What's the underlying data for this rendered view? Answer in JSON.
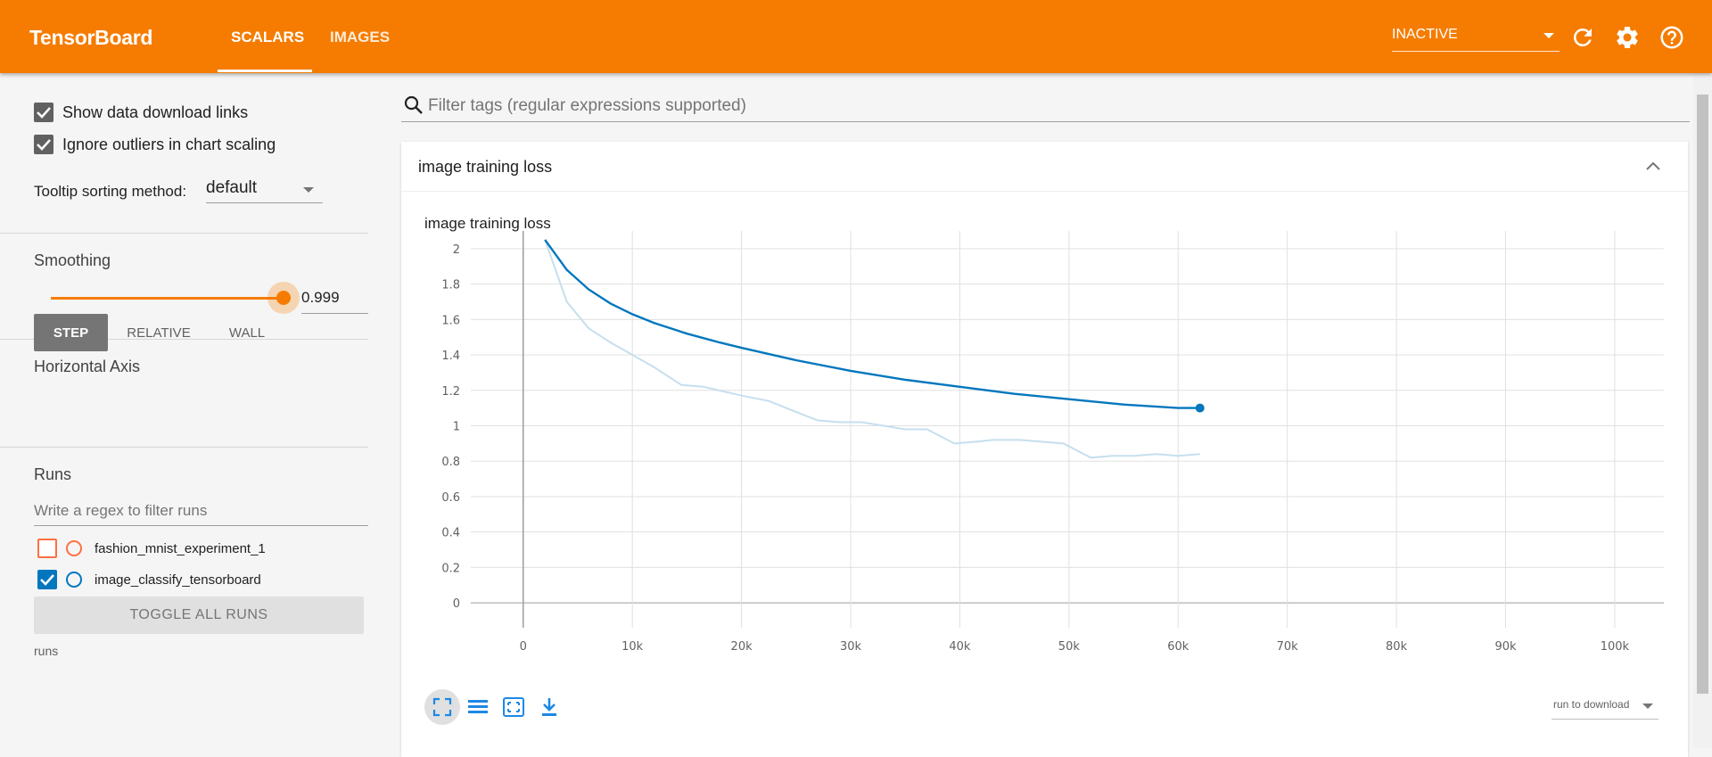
{
  "header": {
    "brand": "TensorBoard",
    "tabs": [
      {
        "label": "SCALARS",
        "active": true
      },
      {
        "label": "IMAGES",
        "active": false
      }
    ],
    "status_select": "INACTIVE",
    "accent_color": "#f57c00"
  },
  "sidebar": {
    "show_download_links": {
      "label": "Show data download links",
      "checked": true
    },
    "ignore_outliers": {
      "label": "Ignore outliers in chart scaling",
      "checked": true
    },
    "tooltip_sort": {
      "label": "Tooltip sorting method:",
      "value": "default"
    },
    "smoothing": {
      "title": "Smoothing",
      "value": "0.999",
      "level": 0.999
    },
    "horizontal_axis": {
      "title": "Horizontal Axis",
      "options": [
        "STEP",
        "RELATIVE",
        "WALL"
      ],
      "selected": "STEP"
    },
    "runs": {
      "title": "Runs",
      "filter_placeholder": "Write a regex to filter runs",
      "items": [
        {
          "name": "fashion_mnist_experiment_1",
          "checked": false,
          "color": "#ff7043"
        },
        {
          "name": "image_classify_tensorboard",
          "checked": true,
          "color": "#0277bd"
        }
      ],
      "toggle_label": "TOGGLE ALL RUNS",
      "footer": "runs"
    }
  },
  "main": {
    "filter_placeholder": "Filter tags (regular expressions supported)",
    "card_title": "image training loss",
    "download_select": "run to download"
  },
  "chart_data": {
    "type": "line",
    "title": "image training loss",
    "xlabel": "",
    "ylabel": "",
    "xlim": [
      -4800,
      104500
    ],
    "ylim": [
      -0.1,
      2.1
    ],
    "x_ticks": [
      0,
      10000,
      20000,
      30000,
      40000,
      50000,
      60000,
      70000,
      80000,
      90000,
      100000
    ],
    "x_tick_labels": [
      "0",
      "10k",
      "20k",
      "30k",
      "40k",
      "50k",
      "60k",
      "70k",
      "80k",
      "90k",
      "100k"
    ],
    "y_ticks": [
      0,
      0.2,
      0.4,
      0.6,
      0.8,
      1,
      1.2,
      1.4,
      1.6,
      1.8,
      2
    ],
    "y_tick_labels": [
      "0",
      "0.2",
      "0.4",
      "0.6",
      "0.8",
      "1",
      "1.2",
      "1.4",
      "1.6",
      "1.8",
      "2"
    ],
    "grid": true,
    "series": [
      {
        "name": "image_classify_tensorboard",
        "style": "raw",
        "color": "#c6dfee",
        "x": [
          2000,
          4000,
          6000,
          8000,
          10000,
          12000,
          14500,
          16500,
          20000,
          22500,
          24500,
          27000,
          29000,
          31000,
          33000,
          35000,
          37000,
          39500,
          41500,
          43000,
          45500,
          47500,
          49500,
          52000,
          54000,
          56000,
          58000,
          60000,
          62000
        ],
        "y": [
          2.05,
          1.7,
          1.55,
          1.47,
          1.4,
          1.33,
          1.23,
          1.22,
          1.17,
          1.14,
          1.09,
          1.03,
          1.02,
          1.02,
          1.0,
          0.98,
          0.98,
          0.9,
          0.91,
          0.92,
          0.92,
          0.91,
          0.9,
          0.82,
          0.83,
          0.83,
          0.84,
          0.83,
          0.84
        ]
      },
      {
        "name": "image_classify_tensorboard",
        "style": "smoothed",
        "color": "#0277bd",
        "x": [
          2000,
          4000,
          6000,
          8000,
          10000,
          12000,
          15000,
          18000,
          20000,
          25000,
          30000,
          35000,
          40000,
          45000,
          50000,
          55000,
          60000,
          62000
        ],
        "y": [
          2.05,
          1.88,
          1.77,
          1.69,
          1.63,
          1.58,
          1.52,
          1.47,
          1.44,
          1.37,
          1.31,
          1.26,
          1.22,
          1.18,
          1.15,
          1.12,
          1.1,
          1.1
        ]
      }
    ]
  }
}
